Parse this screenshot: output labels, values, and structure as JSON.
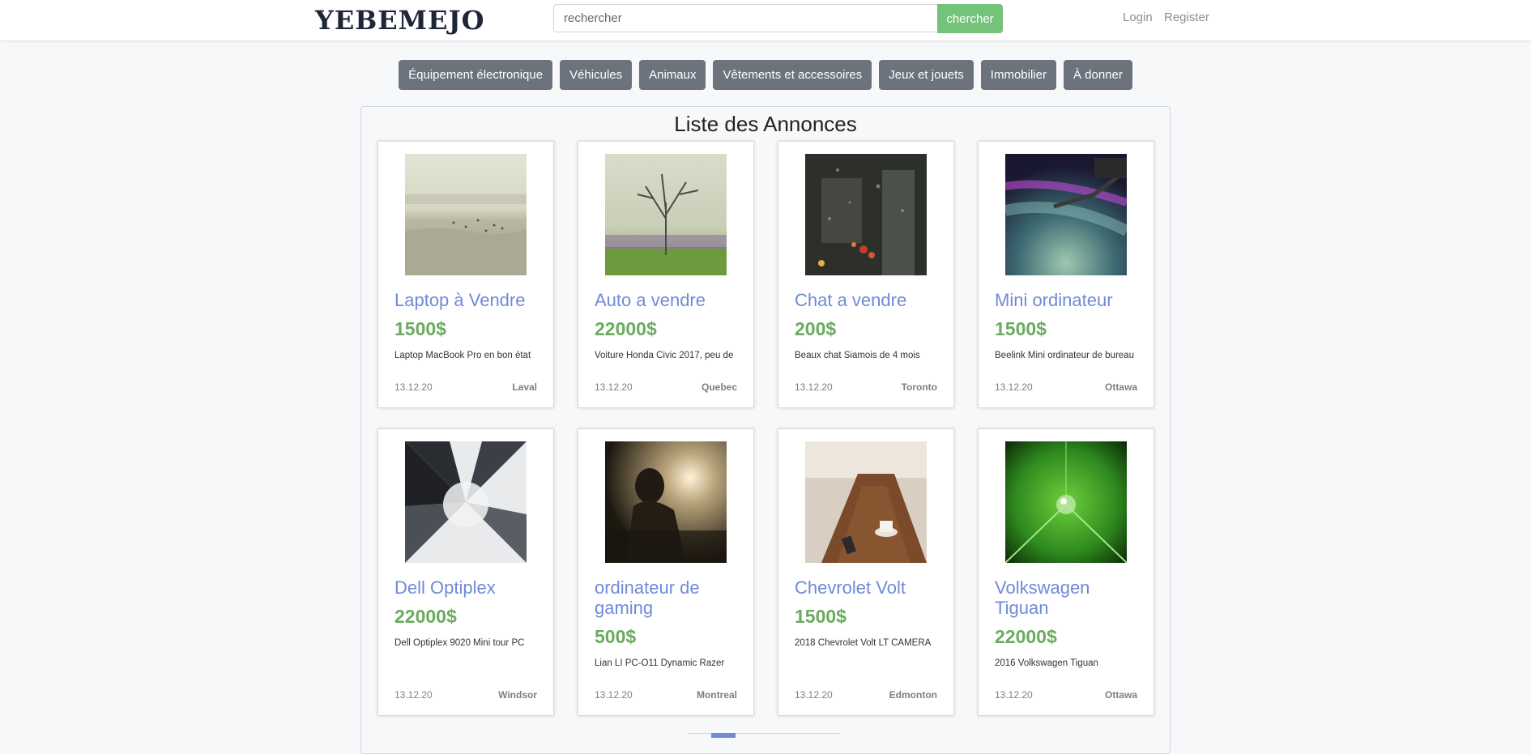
{
  "header": {
    "logo": "YEBEMEJO",
    "search_placeholder": "rechercher",
    "search_button": "chercher",
    "login": "Login",
    "register": "Register"
  },
  "categories": [
    "Équipement électronique",
    "Véhicules",
    "Animaux",
    "Vêtements et accessoires",
    "Jeux et jouets",
    "Immobilier",
    "À donner"
  ],
  "listings_title": "Liste des Annonces",
  "listings": [
    {
      "title": "Laptop à Vendre",
      "price": "1500$",
      "description": "Laptop MacBook Pro en bon état",
      "date": "13.12.20",
      "city": "Laval",
      "image": "beach-photo"
    },
    {
      "title": "Auto a vendre",
      "price": "22000$",
      "description": "Voiture Honda Civic 2017, peu de",
      "date": "13.12.20",
      "city": "Quebec",
      "image": "tree-photo"
    },
    {
      "title": "Chat a vendre",
      "price": "200$",
      "description": "Beaux chat Siamois de 4 mois",
      "date": "13.12.20",
      "city": "Toronto",
      "image": "rain-window-photo"
    },
    {
      "title": "Mini ordinateur",
      "price": "1500$",
      "description": "Beelink Mini ordinateur de bureau",
      "date": "13.12.20",
      "city": "Ottawa",
      "image": "space-station-photo"
    },
    {
      "title": "Dell Optiplex",
      "price": "22000$",
      "description": "Dell Optiplex 9020 Mini tour PC",
      "date": "13.12.20",
      "city": "Windsor",
      "image": "skyscrapers-photo"
    },
    {
      "title": "ordinateur de gaming",
      "price": "500$",
      "description": "Lian LI PC-O11 Dynamic Razer",
      "date": "13.12.20",
      "city": "Montreal",
      "image": "sunset-person-photo"
    },
    {
      "title": "Chevrolet Volt",
      "price": "1500$",
      "description": "2018 Chevrolet Volt LT CAMERA",
      "date": "13.12.20",
      "city": "Edmonton",
      "image": "cafe-table-photo"
    },
    {
      "title": "Volkswagen Tiguan",
      "price": "22000$",
      "description": "2016 Volkswagen Tiguan",
      "date": "13.12.20",
      "city": "Ottawa",
      "image": "green-leaf-photo"
    }
  ],
  "colors": {
    "accent_link": "#6f8ad8",
    "price_green": "#6aab5e",
    "search_button": "#75c27a",
    "category_button": "#6c737d",
    "logo": "#1e2638"
  }
}
